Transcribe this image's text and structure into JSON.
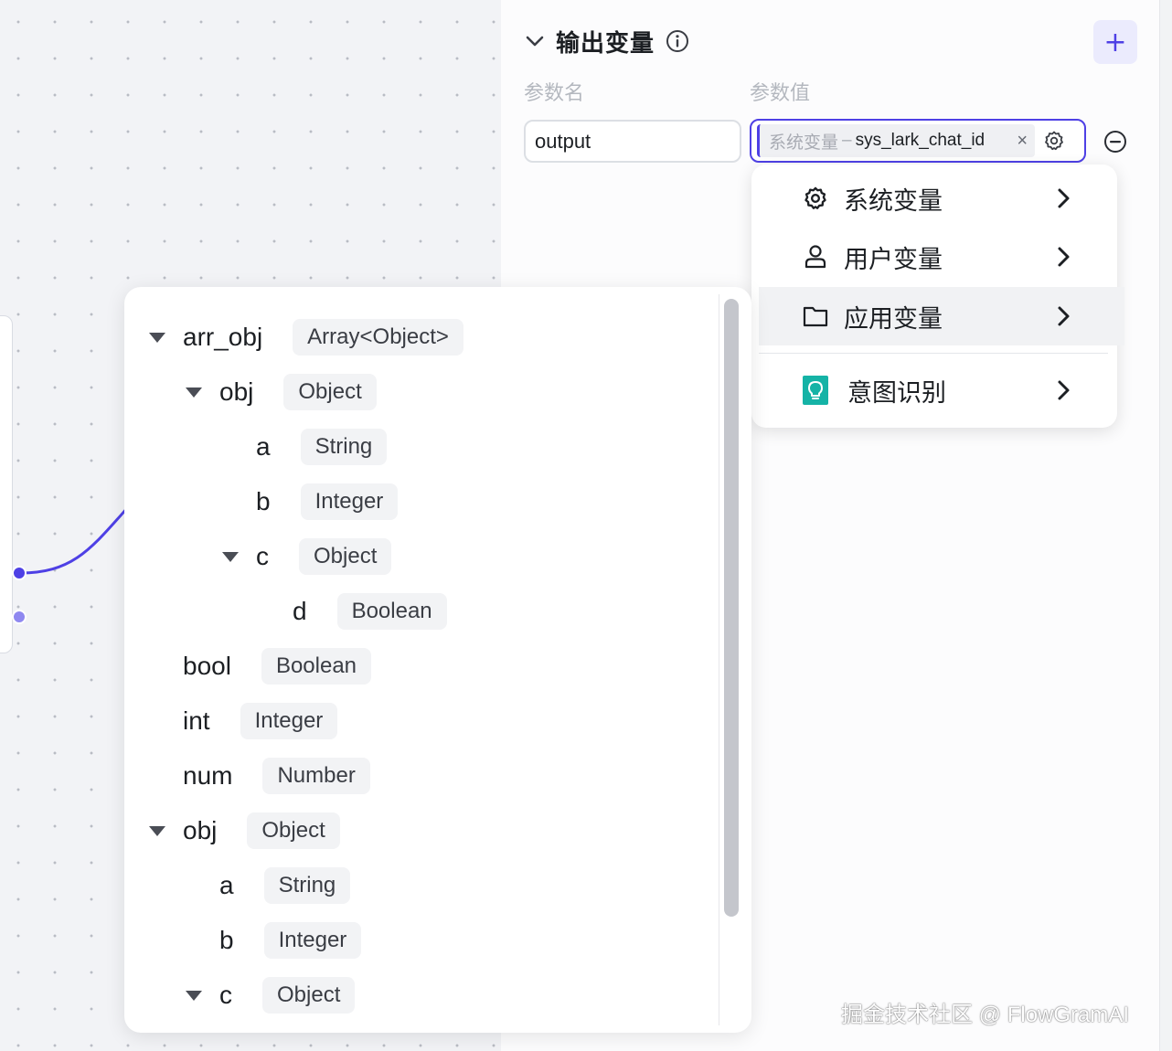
{
  "output_section": {
    "title": "输出变量",
    "add_label": "+",
    "col_name": "参数名",
    "col_value": "参数值",
    "param_name_value": "output",
    "param_value_tag": {
      "prefix": "系统变量",
      "separator": "–",
      "name": "sys_lark_chat_id",
      "close": "×"
    }
  },
  "var_menu": {
    "items": [
      {
        "label": "系统变量",
        "icon": "gear-icon"
      },
      {
        "label": "用户变量",
        "icon": "user-icon"
      },
      {
        "label": "应用变量",
        "icon": "folder-icon"
      },
      {
        "label": "意图识别",
        "icon": "lightbulb-icon"
      }
    ]
  },
  "tree_rows": [
    {
      "name": "arr_obj",
      "type": "Array<Object>"
    },
    {
      "name": "obj",
      "type": "Object"
    },
    {
      "name": "a",
      "type": "String"
    },
    {
      "name": "b",
      "type": "Integer"
    },
    {
      "name": "c",
      "type": "Object"
    },
    {
      "name": "d",
      "type": "Boolean"
    },
    {
      "name": "bool",
      "type": "Boolean"
    },
    {
      "name": "int",
      "type": "Integer"
    },
    {
      "name": "num",
      "type": "Number"
    },
    {
      "name": "obj",
      "type": "Object"
    },
    {
      "name": "a",
      "type": "String"
    },
    {
      "name": "b",
      "type": "Integer"
    },
    {
      "name": "c",
      "type": "Object"
    }
  ],
  "watermark": "掘金技术社区 @ FlowGramAI",
  "colors": {
    "accent": "#4e40e5",
    "intent": "#15b3a6"
  }
}
